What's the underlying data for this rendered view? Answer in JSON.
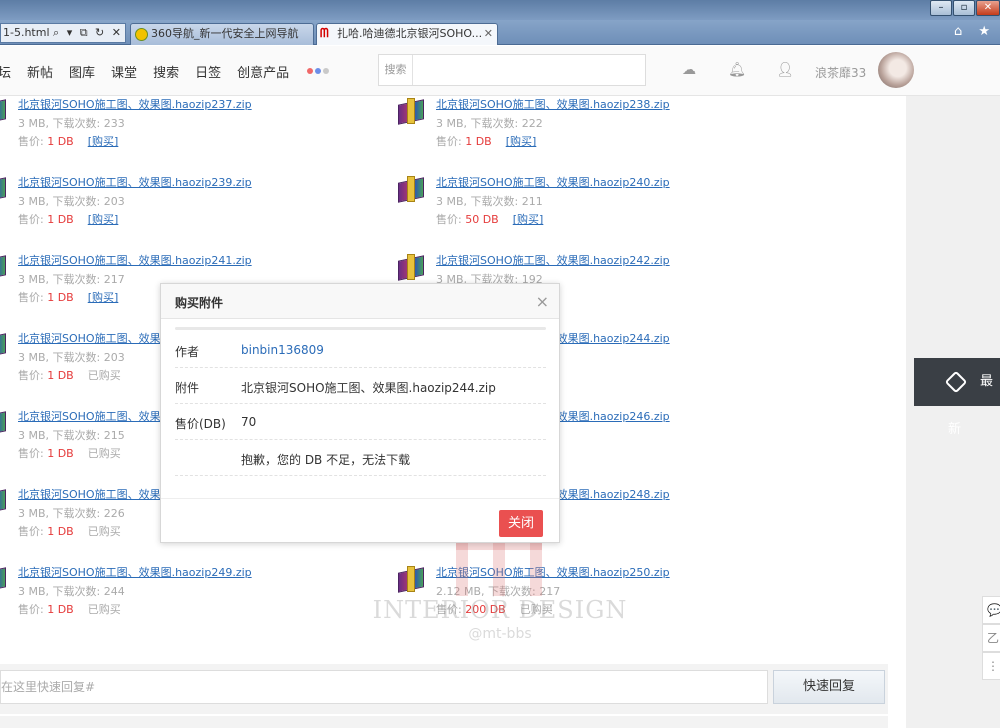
{
  "browser": {
    "address_text": "1-5.html",
    "address_controls": "⌕ ▾ ⧉ ↻ ✕",
    "tabs": [
      {
        "label": "360导航_新一代安全上网导航"
      },
      {
        "label": "扎哈.哈迪德北京银河SOHO...",
        "icon": "ᗰ"
      }
    ],
    "tab_close": "✕",
    "right_icons": "⌂ ★",
    "window_buttons": [
      "–",
      "▫",
      "✕"
    ]
  },
  "nav": {
    "items": [
      "坛",
      "新帖",
      "图库",
      "课堂",
      "搜索",
      "日签",
      "创意产品"
    ],
    "dots": [
      "#f06868",
      "#6c8ee8",
      "#c9c9c9"
    ],
    "search_label": "搜索",
    "search_value": "",
    "icons": [
      "cloud-upload-icon",
      "bell-icon",
      "user-icon"
    ],
    "username": "浪茶靡33"
  },
  "attachments": [
    {
      "name": "北京银河SOHO施工图、效果图.haozip237.zip",
      "meta": "3 MB, 下载次数: 233",
      "price_label": "售价:",
      "price": "1 DB",
      "action": "[购买]",
      "action_type": "buy"
    },
    {
      "name": "北京银河SOHO施工图、效果图.haozip238.zip",
      "meta": "3 MB, 下载次数: 222",
      "price_label": "售价:",
      "price": "1 DB",
      "action": "[购买]",
      "action_type": "buy"
    },
    {
      "name": "北京银河SOHO施工图、效果图.haozip239.zip",
      "meta": "3 MB, 下载次数: 203",
      "price_label": "售价:",
      "price": "1 DB",
      "action": "[购买]",
      "action_type": "buy"
    },
    {
      "name": "北京银河SOHO施工图、效果图.haozip240.zip",
      "meta": "3 MB, 下载次数: 211",
      "price_label": "售价:",
      "price": "50 DB",
      "action": "[购买]",
      "action_type": "buy"
    },
    {
      "name": "北京银河SOHO施工图、效果图.haozip241.zip",
      "meta": "3 MB, 下载次数: 217",
      "price_label": "售价:",
      "price": "1 DB",
      "action": "[购买]",
      "action_type": "buy"
    },
    {
      "name": "北京银河SOHO施工图、效果图.haozip242.zip",
      "meta": "3 MB, 下载次数: 192",
      "price_label": "",
      "price": "",
      "action": "",
      "action_type": "none"
    },
    {
      "name": "北京银河SOHO施工图、效果图.haozip243.zip",
      "meta": "3 MB, 下载次数: 203",
      "price_label": "售价:",
      "price": "1 DB",
      "action": "已购买",
      "action_type": "bought"
    },
    {
      "name": "北京银河SOHO施工图、效果图.haozip244.zip",
      "meta": "",
      "price_label": "",
      "price": "",
      "action": "",
      "action_type": "none"
    },
    {
      "name": "北京银河SOHO施工图、效果图.haozip245.zip",
      "meta": "3 MB, 下载次数: 215",
      "price_label": "售价:",
      "price": "1 DB",
      "action": "已购买",
      "action_type": "bought"
    },
    {
      "name": "北京银河SOHO施工图、效果图.haozip246.zip",
      "meta": "",
      "price_label": "",
      "price": "",
      "action": "",
      "action_type": "none"
    },
    {
      "name": "北京银河SOHO施工图、效果图.haozip247.zip",
      "meta": "3 MB, 下载次数: 226",
      "price_label": "售价:",
      "price": "1 DB",
      "action": "已购买",
      "action_type": "bought"
    },
    {
      "name": "北京银河SOHO施工图、效果图.haozip248.zip",
      "meta": "",
      "price_label": "",
      "price": "",
      "action": "",
      "action_type": "none"
    },
    {
      "name": "北京银河SOHO施工图、效果图.haozip249.zip",
      "meta": "3 MB, 下载次数: 244",
      "price_label": "售价:",
      "price": "1 DB",
      "action": "已购买",
      "action_type": "bought"
    },
    {
      "name": "北京银河SOHO施工图、效果图.haozip250.zip",
      "meta": "2.12 MB, 下载次数: 217",
      "price_label": "售价:",
      "price": "200 DB",
      "action": "已购买",
      "action_type": "bought"
    }
  ],
  "modal": {
    "title": "购买附件",
    "close_glyph": "×",
    "rows": [
      {
        "key": "作者",
        "value": "binbin136809"
      },
      {
        "key": "附件",
        "value": "北京银河SOHO施工图、效果图.haozip244.zip"
      },
      {
        "key": "售价(DB)",
        "value": "70"
      },
      {
        "key": "",
        "value": "抱歉，您的 DB 不足，无法下载"
      }
    ],
    "close_button": "关闭"
  },
  "watermark": {
    "line1": "INTERIOR DESIGN",
    "line2": "@mt-bbs"
  },
  "reply": {
    "placeholder": "在这里快速回复#",
    "button": "快速回复"
  },
  "side": {
    "newest_label": "最新",
    "tools": [
      "💬",
      "乙",
      "⋮⋮"
    ]
  }
}
